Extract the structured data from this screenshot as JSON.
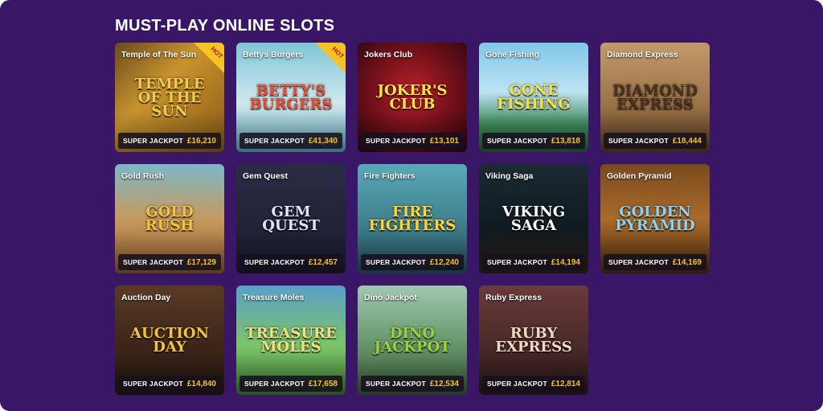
{
  "heading": "MUST-PLAY ONLINE SLOTS",
  "jackpot_label": "SUPER JACKPOT",
  "hot_label": "HOT",
  "colors": {
    "panel": "#3a1766",
    "accent_yellow": "#f6c324",
    "jackpot_bar": "#16101e"
  },
  "games": [
    {
      "name": "Temple of The Sun",
      "logo": "TEMPLE of the SUN",
      "jackpot": "£16,210",
      "hot": true,
      "bg": "linear-gradient(135deg,#6b4a1c 0%,#c8932e 40%,#8a5a16 100%)",
      "logo_color": "#f2c94c"
    },
    {
      "name": "Bettys Burgers",
      "logo": "BETTY'S BURGERS",
      "jackpot": "£41,340",
      "hot": true,
      "bg": "linear-gradient(180deg,#7fc6d6 0%,#cfe8ef 55%,#5ea8bb 100%)",
      "logo_color": "#e84a2e"
    },
    {
      "name": "Jokers Club",
      "logo": "JOKER'S CLUB",
      "jackpot": "£13,101",
      "hot": false,
      "bg": "radial-gradient(circle at 50% 45%,#b8202a 0%,#6d0f18 55%,#2b0610 100%)",
      "logo_color": "#ffe14d"
    },
    {
      "name": "Gone Fishing",
      "logo": "GONE FISHING",
      "jackpot": "£13,818",
      "hot": false,
      "bg": "linear-gradient(180deg,#7fc7e8 0%,#bde3f2 45%,#3d8a5a 75%,#2c5e3e 100%)",
      "logo_color": "#f6e04a"
    },
    {
      "name": "Diamond Express",
      "logo": "DIAMOND EXPRESS",
      "jackpot": "£18,444",
      "hot": false,
      "bg": "linear-gradient(180deg,#c29a6a 0%,#9c7448 55%,#5a3e22 100%)",
      "logo_color": "#4a3220"
    },
    {
      "name": "Gold Rush",
      "logo": "GOLD RUSH",
      "jackpot": "£17,129",
      "hot": false,
      "bg": "linear-gradient(180deg,#7bb7c9 0%,#c79a5e 50%,#8a5a2a 100%)",
      "logo_color": "#f3c340"
    },
    {
      "name": "Gem Quest",
      "logo": "GEM QUEST",
      "jackpot": "£12,457",
      "hot": false,
      "bg": "linear-gradient(180deg,#2a2d45 0%,#1a1b2c 100%)",
      "logo_color": "#dfe3f4"
    },
    {
      "name": "Fire Fighters",
      "logo": "FIRE FIGHTERS",
      "jackpot": "£12,240",
      "hot": false,
      "bg": "linear-gradient(180deg,#5aa9b8 0%,#3f7f8c 55%,#24505a 100%)",
      "logo_color": "#ffd23a"
    },
    {
      "name": "Viking Saga",
      "logo": "VIKING SAGA",
      "jackpot": "£14,194",
      "hot": false,
      "bg": "linear-gradient(180deg,#1c2a33 0%,#0f1a20 60%,#2e2218 100%)",
      "logo_color": "#ffffff"
    },
    {
      "name": "Golden Pyramid",
      "logo": "GOLDEN PYRAMID",
      "jackpot": "£14,169",
      "hot": false,
      "bg": "linear-gradient(180deg,#7a4a1e 0%,#a86b2a 50%,#4a2a10 100%)",
      "logo_color": "#8fd0f0"
    },
    {
      "name": "Auction Day",
      "logo": "AUCTION DAY",
      "jackpot": "£14,840",
      "hot": false,
      "bg": "linear-gradient(180deg,#5a3a26 0%,#3a2418 60%,#24160e 100%)",
      "logo_color": "#f3c340"
    },
    {
      "name": "Treasure Moles",
      "logo": "TREASURE MOLES",
      "jackpot": "£17,658",
      "hot": false,
      "bg": "linear-gradient(180deg,#5aa0c8 0%,#7cc46a 55%,#3c7a2e 100%)",
      "logo_color": "#f3e07a"
    },
    {
      "name": "Dino Jackpot",
      "logo": "DINO JACKPOT",
      "jackpot": "£12,534",
      "hot": false,
      "bg": "linear-gradient(180deg,#9fc9b0 0%,#6a9a6e 50%,#3a5a36 100%)",
      "logo_color": "#9bd23a"
    },
    {
      "name": "Ruby Express",
      "logo": "RUBY EXPRESS",
      "jackpot": "£12,814",
      "hot": false,
      "bg": "linear-gradient(180deg,#6a3a3a 0%,#4a2a2a 55%,#2a1818 100%)",
      "logo_color": "#f0d8c0"
    }
  ]
}
